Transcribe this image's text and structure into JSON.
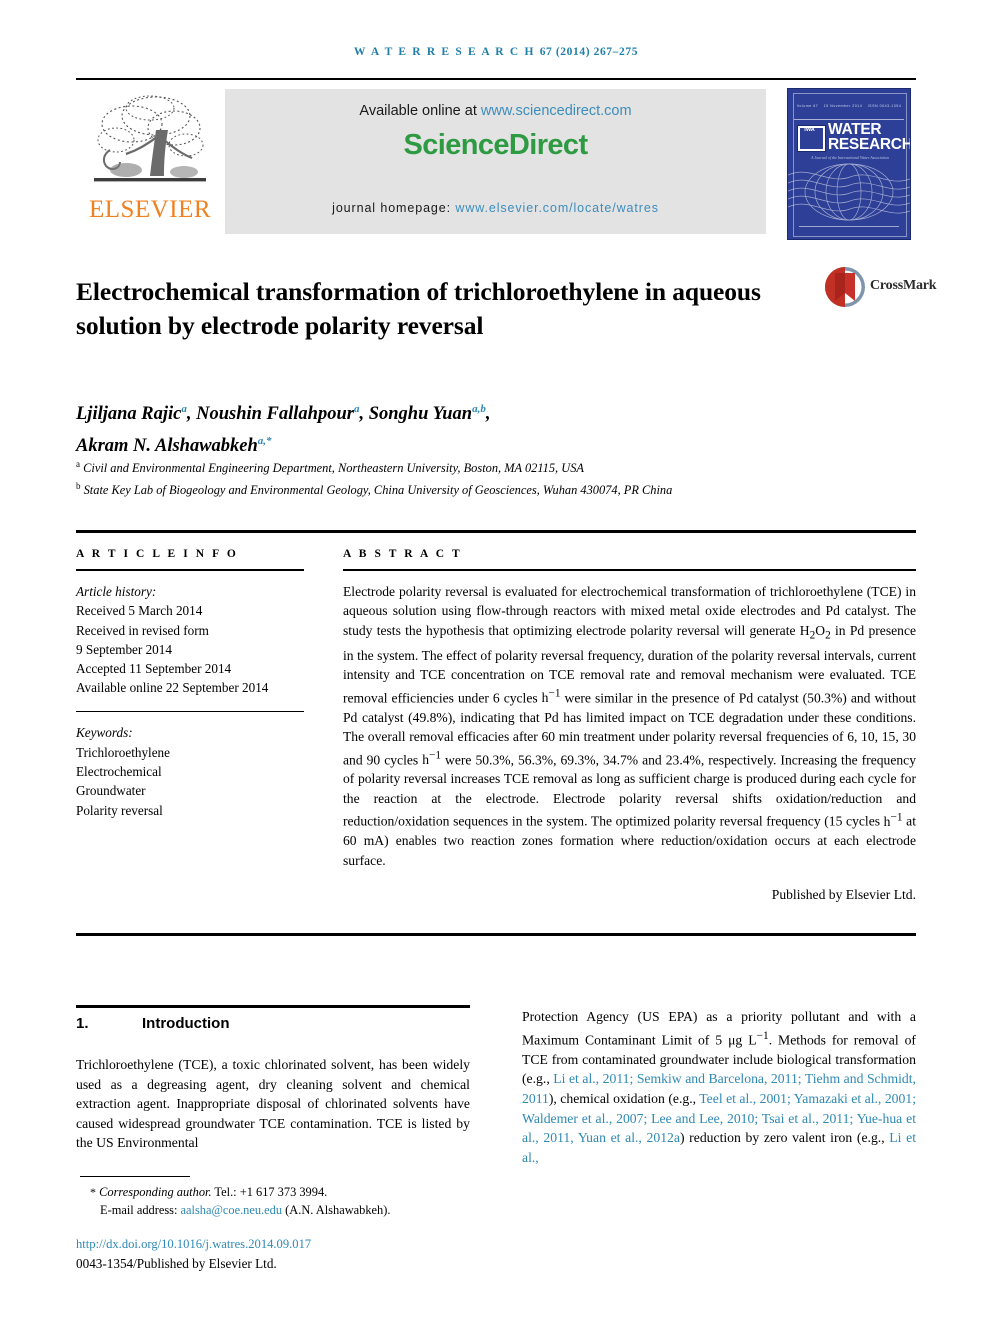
{
  "running_head": {
    "journal": "W A T E R   R E S E A R C H",
    "volume_issue": "67 (2014) 267–275"
  },
  "masthead": {
    "available_prefix": "Available online at ",
    "available_link": "www.sciencedirect.com",
    "sciencedirect_logo": "ScienceDirect",
    "homepage_prefix": "journal homepage: ",
    "homepage_link": "www.elsevier.com/locate/watres",
    "elsevier_wordmark": "ELSEVIER",
    "elsevier_tree_icon": "tree-logo-icon",
    "colors": {
      "sciencedirect_green": "#2e9b43",
      "link_blue": "#3c8dbc",
      "elsevier_orange": "#f08020",
      "banner_grey": "#e3e3e3",
      "cover_blue": "#2d3f96",
      "running_head_blue": "#1f7fa8"
    }
  },
  "cover": {
    "title_line1": "WATER",
    "title_line2": "RESEARCH",
    "iwa_logo": "IWA",
    "subtitle": "A Journal of the International Water Association",
    "top_left": "Volume 67",
    "top_mid": "15 November 2014",
    "top_right": "ISSN 0043-1354"
  },
  "article": {
    "title": "Electrochemical transformation of trichloroethylene in aqueous solution by electrode polarity reversal",
    "crossmark_label": "CrossMark",
    "authors_line1_pre": "Ljiljana Rajic ",
    "authors": [
      {
        "name": "Ljiljana Rajic",
        "sup": "a",
        "sep": ", "
      },
      {
        "name": "Noushin Fallahpour",
        "sup": "a",
        "sep": ", "
      },
      {
        "name": "Songhu Yuan",
        "sup": "a,b",
        "sep": ","
      },
      {
        "name": "Akram N. Alshawabkeh",
        "sup": "a,*",
        "sep": ""
      }
    ],
    "affiliations": [
      {
        "marker": "a",
        "text": "Civil and Environmental Engineering Department, Northeastern University, Boston, MA 02115, USA"
      },
      {
        "marker": "b",
        "text": "State Key Lab of Biogeology and Environmental Geology, China University of Geosciences, Wuhan 430074, PR China"
      }
    ]
  },
  "article_info": {
    "heading": "A R T I C L E   I N F O",
    "history_label": "Article history:",
    "history": [
      "Received 5 March 2014",
      "Received in revised form",
      "9 September 2014",
      "Accepted 11 September 2014",
      "Available online 22 September 2014"
    ],
    "keywords_label": "Keywords:",
    "keywords": [
      "Trichloroethylene",
      "Electrochemical",
      "Groundwater",
      "Polarity reversal"
    ]
  },
  "abstract": {
    "heading": "A B S T R A C T",
    "para1": "Electrode polarity reversal is evaluated for electrochemical transformation of trichloroethylene (TCE) in aqueous solution using flow-through reactors with mixed metal oxide electrodes and Pd catalyst. The study tests the hypothesis that optimizing electrode polarity reversal will generate ",
    "h2o2": "H2O2",
    "para2": " in Pd presence in the system. The effect of polarity reversal frequency, duration of the polarity reversal intervals, current intensity and TCE concentration on TCE removal rate and removal mechanism were evaluated. TCE removal efficiencies under 6 cycles ",
    "hinv1": "h−1",
    "para3": " were similar in the presence of Pd catalyst (50.3%) and without Pd catalyst (49.8%), indicating that Pd has limited impact on TCE degradation under these conditions. The overall removal efficacies after 60 min treatment under polarity reversal frequencies of 6, 10, 15, 30 and 90 cycles ",
    "hinv2": "h−1",
    "para4": " were 50.3%, 56.3%, 69.3%, 34.7% and 23.4%, respectively. Increasing the frequency of polarity reversal increases TCE removal as long as sufficient charge is produced during each cycle for the reaction at the electrode. Electrode polarity reversal shifts oxidation/reduction and reduction/oxidation sequences in the system. The optimized polarity reversal frequency (15 cycles ",
    "hinv3": "h−1",
    "para5": " at 60 mA) enables two reaction zones formation where reduction/oxidation occurs at each electrode surface.",
    "publisher": "Published by Elsevier Ltd."
  },
  "body": {
    "section_number": "1.",
    "section_title": "Introduction",
    "left_column": "Trichloroethylene (TCE), a toxic chlorinated solvent, has been widely used as a degreasing agent, dry cleaning solvent and chemical extraction agent. Inappropriate disposal of chlorinated solvents have caused widespread groundwater TCE contamination. TCE is listed by the US Environmental",
    "right_col_part1": "Protection Agency (US EPA) as a priority pollutant and with a Maximum Contaminant Limit of 5 μg L",
    "right_col_sup": "−1",
    "right_col_part2": ". Methods for removal of TCE from contaminated groundwater include biological transformation (e.g., ",
    "right_col_cite1": "Li et al., 2011; Semkiw and Barcelona, 2011; Tiehm and Schmidt, 2011",
    "right_col_part3": "), chemical oxidation (e.g., ",
    "right_col_cite2": "Teel et al., 2001; Yamazaki et al., 2001; Waldemer et al., 2007; Lee and Lee, 2010; Tsai et al., 2011; Yue-hua et al., 2011, Yuan et al., 2012a",
    "right_col_part4": ") reduction by zero valent iron (e.g., ",
    "right_col_cite3": "Li et al.,",
    "right_col_part5": ""
  },
  "footer": {
    "corr_marker": "*",
    "corr_text": "Corresponding author.",
    "corr_tel": " Tel.: +1 617 373 3994.",
    "email_label": "E-mail address: ",
    "email": "aalsha@coe.neu.edu",
    "email_attrib": " (A.N. Alshawabkeh).",
    "doi": "http://dx.doi.org/10.1016/j.watres.2014.09.017",
    "issn": "0043-1354/Published by Elsevier Ltd."
  }
}
